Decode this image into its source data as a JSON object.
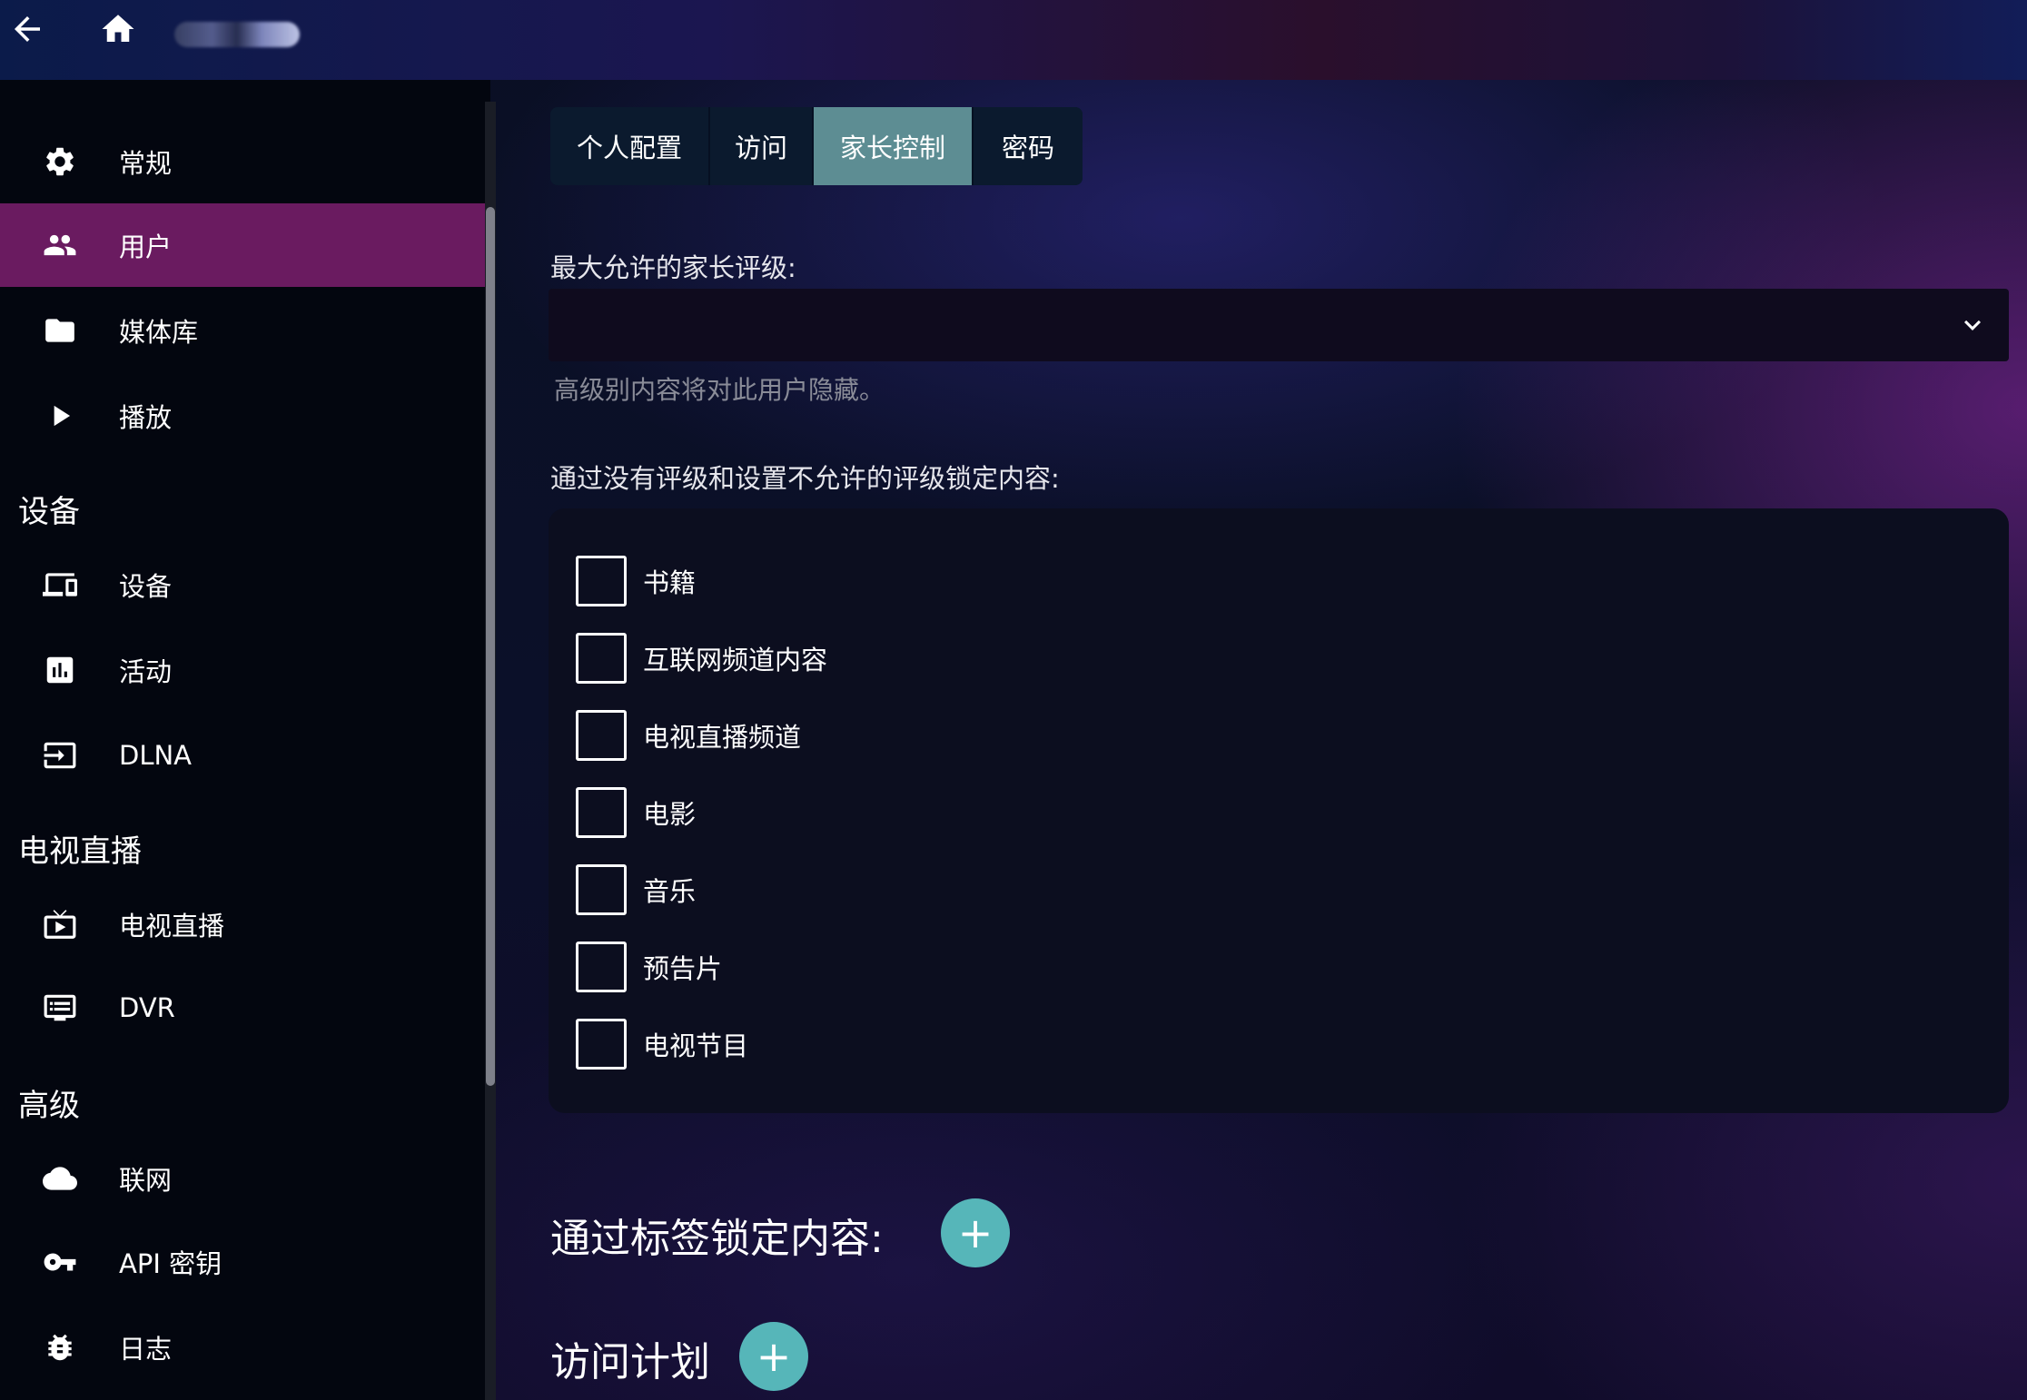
{
  "sidebar": {
    "items": [
      {
        "label": "常规",
        "icon": "gear-icon"
      },
      {
        "label": "用户",
        "icon": "people-icon"
      },
      {
        "label": "媒体库",
        "icon": "folder-icon"
      },
      {
        "label": "播放",
        "icon": "play-icon"
      }
    ],
    "sections": {
      "devices": {
        "title": "设备",
        "items": [
          {
            "label": "设备",
            "icon": "devices-icon"
          },
          {
            "label": "活动",
            "icon": "bar-chart-icon"
          },
          {
            "label": "DLNA",
            "icon": "input-icon"
          }
        ]
      },
      "livetv": {
        "title": "电视直播",
        "items": [
          {
            "label": "电视直播",
            "icon": "live-tv-icon"
          },
          {
            "label": "DVR",
            "icon": "dvr-icon"
          }
        ]
      },
      "advanced": {
        "title": "高级",
        "items": [
          {
            "label": "联网",
            "icon": "cloud-icon"
          },
          {
            "label": "API 密钥",
            "icon": "key-icon"
          },
          {
            "label": "日志",
            "icon": "bug-icon"
          }
        ]
      }
    }
  },
  "tabs": [
    {
      "label": "个人配置"
    },
    {
      "label": "访问"
    },
    {
      "label": "家长控制",
      "active": true
    },
    {
      "label": "密码"
    }
  ],
  "parental": {
    "max_rating_label": "最大允许的家长评级:",
    "max_rating_value": "",
    "hint": "高级别内容将对此用户隐藏。",
    "block_unrated_label": "通过没有评级和设置不允许的评级锁定内容:",
    "checkboxes": [
      {
        "label": "书籍",
        "checked": false
      },
      {
        "label": "互联网频道内容",
        "checked": false
      },
      {
        "label": "电视直播频道",
        "checked": false
      },
      {
        "label": "电影",
        "checked": false
      },
      {
        "label": "音乐",
        "checked": false
      },
      {
        "label": "预告片",
        "checked": false
      },
      {
        "label": "电视节目",
        "checked": false
      }
    ],
    "block_tags_title": "通过标签锁定内容:",
    "access_schedule_title": "访问计划",
    "add_symbol": "+"
  },
  "colors": {
    "active_nav": "#6a1b60",
    "active_tab": "#5d8d93",
    "add_button": "#56b6b9"
  }
}
